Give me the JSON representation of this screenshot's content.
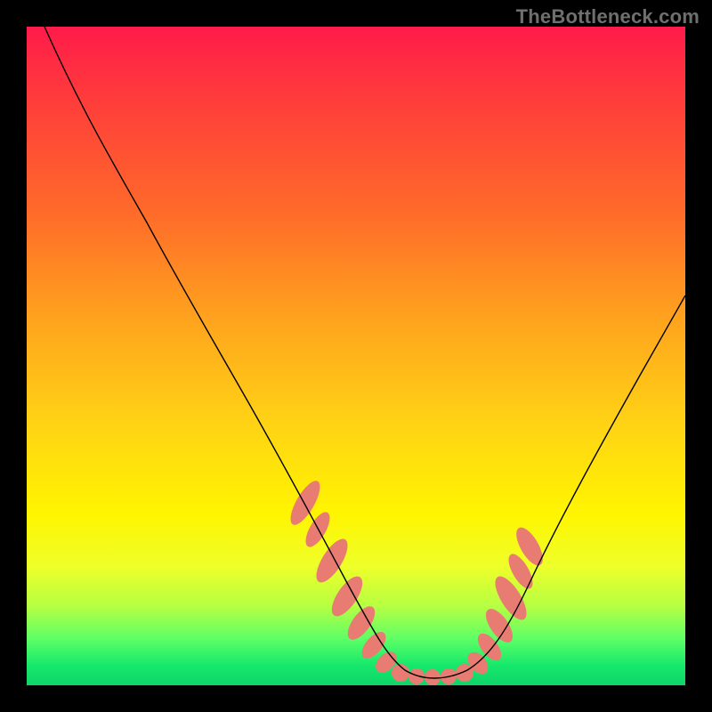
{
  "watermark": {
    "text": "TheBottleneck.com"
  },
  "colors": {
    "background": "#000000",
    "gradient_top": "#ff1b4a",
    "gradient_bottom": "#0fd46a",
    "curve": "#000000",
    "marker": "#e87c72",
    "watermark": "#6f6f6f"
  },
  "chart_data": {
    "type": "line",
    "title": "",
    "xlabel": "",
    "ylabel": "",
    "xlim": [
      0,
      100
    ],
    "ylim": [
      0,
      100
    ],
    "grid": false,
    "series": [
      {
        "name": "curve",
        "x": [
          3,
          6,
          10,
          14,
          18,
          22,
          26,
          30,
          34,
          38,
          42,
          46,
          50,
          54,
          56,
          58,
          60,
          64,
          68,
          72,
          76,
          80,
          84,
          88,
          92,
          96,
          100
        ],
        "values": [
          100,
          95,
          89,
          82,
          75,
          68,
          61,
          55,
          48,
          41,
          34,
          27,
          20,
          12,
          8,
          5,
          3,
          3,
          4,
          7,
          12,
          18,
          25,
          33,
          42,
          52,
          62
        ]
      }
    ],
    "markers": {
      "name": "highlighted-points",
      "color": "#e87c72",
      "x": [
        42,
        46,
        48,
        50,
        52,
        54,
        55,
        56,
        58,
        60,
        62,
        64,
        66,
        68,
        70,
        71,
        72,
        73,
        74
      ],
      "values": [
        34,
        25,
        19,
        14,
        10,
        7,
        6,
        5,
        4,
        3,
        3,
        3,
        4,
        5,
        8,
        10,
        12,
        15,
        18
      ]
    }
  }
}
